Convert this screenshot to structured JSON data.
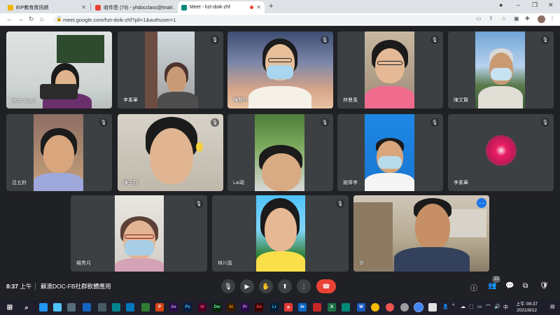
{
  "browser": {
    "tabs": [
      {
        "label": "EIP教育資訊網",
        "color": "#f4b400"
      },
      {
        "label": "收件匣 (79) - yhdocclass@tma...",
        "color": "#ea4335"
      },
      {
        "label": "Meet - hzt-doik-zhf",
        "color": "#00897b"
      }
    ],
    "new_tab": "+",
    "url": "meet.google.com/hzt-doik-zhf?pli=1&authuser=1"
  },
  "participants": [
    {
      "name": "DOC Suao"
    },
    {
      "name": "李素華"
    },
    {
      "name": "陳慧玲"
    },
    {
      "name": "林曼風"
    },
    {
      "name": "陳文賢"
    },
    {
      "name": "呂五鈴"
    },
    {
      "name": "陳玉燕"
    },
    {
      "name": "Lai政"
    },
    {
      "name": "謝偉李"
    },
    {
      "name": "李素華"
    },
    {
      "name": "楊秀月"
    },
    {
      "name": "林川盈"
    },
    {
      "name": "你"
    }
  ],
  "meeting": {
    "time": "8:37",
    "ampm": "上午",
    "title": "蘇澳DOC-FB社群軟體應用",
    "participant_count": "13"
  },
  "taskbar": {
    "clock_top": "上午 08:37",
    "clock_bottom": "2021/8/12"
  },
  "colors": {
    "hangup": "#ea4335",
    "accent": "#8ab4f8",
    "tile": "#3c4043"
  }
}
